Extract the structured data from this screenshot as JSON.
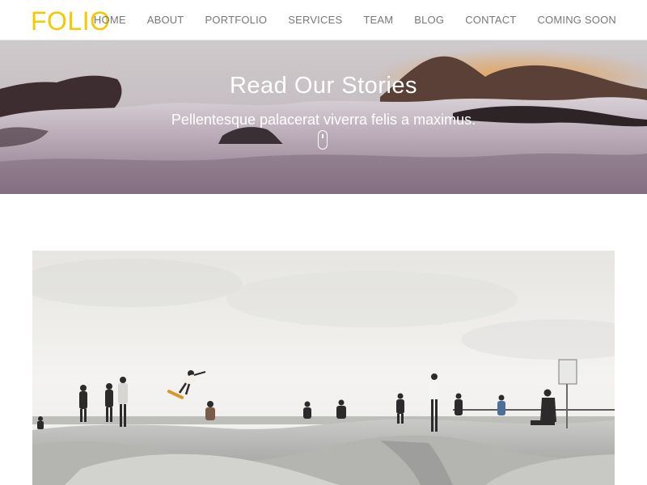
{
  "brand": {
    "name": "FOLIO",
    "color": "#f5c800"
  },
  "nav": {
    "items": [
      {
        "label": "HOME"
      },
      {
        "label": "ABOUT"
      },
      {
        "label": "PORTFOLIO"
      },
      {
        "label": "SERVICES"
      },
      {
        "label": "TEAM"
      },
      {
        "label": "BLOG"
      },
      {
        "label": "CONTACT"
      },
      {
        "label": "COMING SOON"
      }
    ]
  },
  "hero": {
    "title": "Read Our Stories",
    "subtitle": "Pellentesque palacerat viverra felis a maximus.",
    "scroll_icon": "mouse-scroll-icon"
  },
  "post": {
    "image_subject": "skatepark-photo"
  }
}
